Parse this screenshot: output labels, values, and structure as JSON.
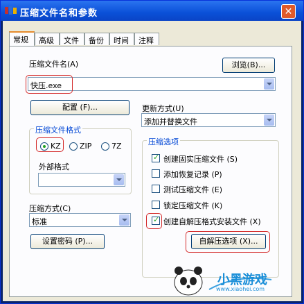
{
  "window": {
    "title": "压缩文件名和参数",
    "close_label": "✕"
  },
  "tabs": [
    "常规",
    "高级",
    "文件",
    "备份",
    "时间",
    "注释"
  ],
  "archive_name": {
    "label": "压缩文件名(A)",
    "value": "快压.exe",
    "browse_label": "浏览(B)..."
  },
  "config_button": "配置 (F)...",
  "update_method": {
    "label": "更新方式(U)",
    "value": "添加并替换文件"
  },
  "format": {
    "group_title": "压缩文件格式",
    "options": [
      {
        "label": "KZ",
        "selected": true
      },
      {
        "label": "ZIP",
        "selected": false
      },
      {
        "label": "7Z",
        "selected": false
      }
    ],
    "external_label": "外部格式",
    "external_value": ""
  },
  "compression_method": {
    "label": "压缩方式(C)",
    "value": "标准"
  },
  "password_button": "设置密码 (P)...",
  "options": {
    "group_title": "压缩选项",
    "items": [
      {
        "label": "创建固实压缩文件 (S)",
        "checked": true
      },
      {
        "label": "添加恢复记录 (P)",
        "checked": false
      },
      {
        "label": "测试压缩文件 (E)",
        "checked": false
      },
      {
        "label": "锁定压缩文件 (K)",
        "checked": false
      },
      {
        "label": "创建自解压格式安装文件 (X)",
        "checked": true
      }
    ],
    "sfx_button": "自解压选项 (X)..."
  },
  "watermark": {
    "brand": "小黑游戏",
    "url": "www.xiaohei.com"
  },
  "colors": {
    "title_bar": "#0a50d8",
    "highlight": "#d42a2a",
    "check": "#21a121"
  }
}
